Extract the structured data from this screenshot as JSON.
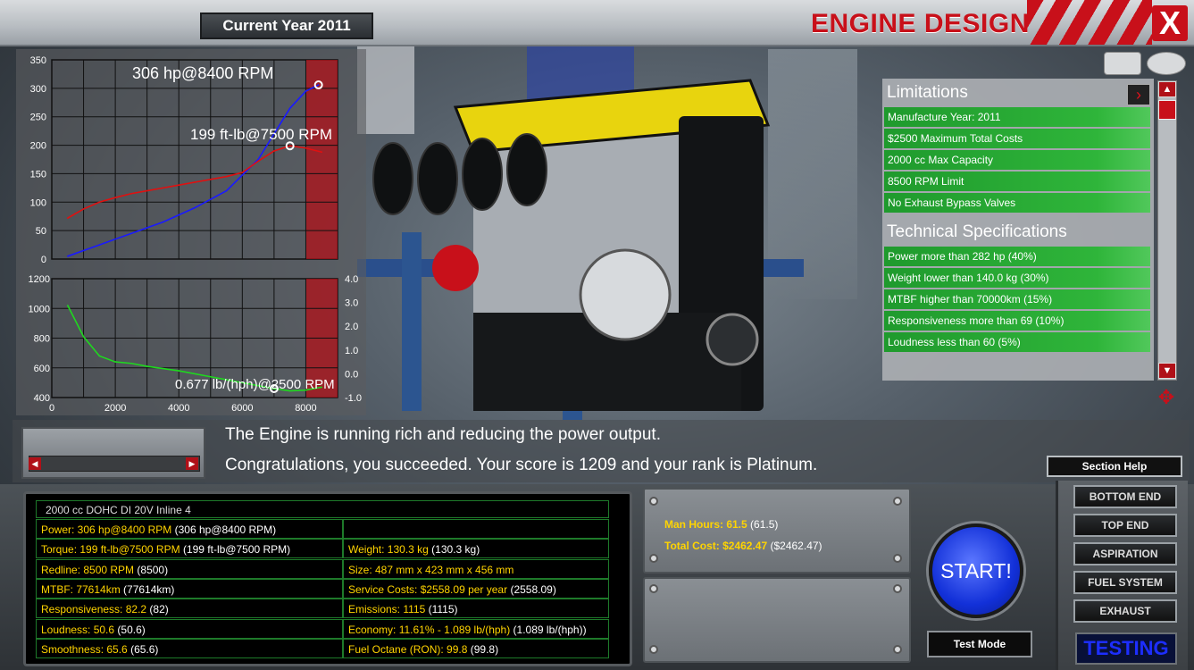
{
  "header": {
    "current_year": "Current Year 2011",
    "title": "ENGINE DESIGN",
    "close_label": "X"
  },
  "graphs": {
    "top_y_ticks": [
      "350",
      "300",
      "250",
      "200",
      "150",
      "100",
      "50",
      "0"
    ],
    "bottom_y_left_ticks": [
      "1200",
      "1000",
      "800",
      "600",
      "400"
    ],
    "bottom_y_right_ticks": [
      "4.0",
      "3.0",
      "2.0",
      "1.0",
      "0.0",
      "-1.0"
    ],
    "x_ticks": [
      "0",
      "2000",
      "4000",
      "6000",
      "8000"
    ],
    "power_label": "306 hp@8400 RPM",
    "torque_label": "199 ft-lb@7500 RPM",
    "economy_label": "0.677 lb/(hph)@2500 RPM"
  },
  "chart_data": {
    "type": "line",
    "x_range": [
      0,
      9000
    ],
    "charts": [
      {
        "ylim": [
          0,
          350
        ],
        "series": [
          {
            "color": "#1a1aff",
            "x": [
              500,
              1500,
              2500,
              3500,
              4500,
              5500,
              6500,
              7000,
              7500,
              8000,
              8400
            ],
            "y": [
              5,
              25,
              45,
              65,
              90,
              120,
              175,
              220,
              265,
              295,
              306
            ]
          },
          {
            "color": "#e01010",
            "x": [
              500,
              1000,
              1500,
              2000,
              2500,
              3000,
              3500,
              4000,
              4500,
              5000,
              5500,
              6000,
              6500,
              7000,
              7500,
              8000,
              8500
            ],
            "y": [
              72,
              88,
              100,
              108,
              115,
              120,
              125,
              130,
              135,
              140,
              145,
              152,
              172,
              190,
              199,
              195,
              188
            ]
          }
        ]
      },
      {
        "ylim": [
          400,
          1200
        ],
        "series": [
          {
            "color": "#1fd81f",
            "x": [
              500,
              1000,
              1500,
              2000,
              2500,
              3000,
              4000,
              5000,
              6000,
              7000,
              7500,
              8000,
              8500
            ],
            "y": [
              1020,
              810,
              680,
              640,
              630,
              610,
              580,
              540,
              500,
              460,
              445,
              450,
              470
            ]
          }
        ]
      }
    ]
  },
  "limitations": {
    "title": "Limitations",
    "items": [
      "Manufacture Year: 2011",
      "$2500 Maximum Total Costs",
      "2000 cc Max Capacity",
      "8500 RPM Limit",
      "No Exhaust Bypass Valves"
    ]
  },
  "specs": {
    "title": "Technical Specifications",
    "items": [
      "Power more than 282 hp (40%)",
      "Weight lower than 140.0 kg (30%)",
      "MTBF higher than 70000km (15%)",
      "Responsiveness more than 69 (10%)",
      "Loudness less than 60 (5%)"
    ]
  },
  "messages": {
    "line1": "The Engine is running rich and reducing the power output.",
    "line2": "Congratulations, you succeeded. Your score is 1209  and your rank is Platinum."
  },
  "section_help": "Section Help",
  "stats": {
    "title": "2000 cc DOHC DI 20V Inline 4",
    "left": [
      {
        "label": "Power: 306 hp@8400 RPM",
        "extra": " (306 hp@8400 RPM)"
      },
      {
        "label": "Torque: 199 ft-lb@7500 RPM",
        "extra": " (199 ft-lb@7500 RPM)"
      },
      {
        "label": "Redline: 8500 RPM",
        "extra": " (8500)"
      },
      {
        "label": "MTBF: 77614km",
        "extra": " (77614km)"
      },
      {
        "label": "Responsiveness: 82.2",
        "extra": " (82)"
      },
      {
        "label": "Loudness: 50.6",
        "extra": " (50.6)"
      },
      {
        "label": "Smoothness: 65.6",
        "extra": " (65.6)"
      }
    ],
    "right": [
      {
        "label": "Weight: 130.3 kg",
        "extra": " (130.3 kg)"
      },
      {
        "label": "Size: 487 mm x 423 mm x 456 mm",
        "extra": ""
      },
      {
        "label": "Service Costs: $2558.09 per year",
        "extra": " (2558.09)"
      },
      {
        "label": "Emissions: 1115",
        "extra": " (1115)"
      },
      {
        "label": "Economy: 11.61% - 1.089 lb/(hph)",
        "extra": " (1.089 lb/(hph))"
      },
      {
        "label": "Fuel Octane (RON): 99.8",
        "extra": " (99.8)"
      }
    ]
  },
  "costs": {
    "man_hours": "Man Hours: 61.5",
    "man_hours_extra": " (61.5)",
    "total_cost": "Total Cost: $2462.47",
    "total_cost_extra": " ($2462.47)"
  },
  "start_label": "START!",
  "test_mode_label": "Test Mode",
  "nav": {
    "bottom_end": "BOTTOM END",
    "top_end": "TOP END",
    "aspiration": "ASPIRATION",
    "fuel_system": "FUEL SYSTEM",
    "exhaust": "EXHAUST",
    "testing": "TESTING"
  }
}
